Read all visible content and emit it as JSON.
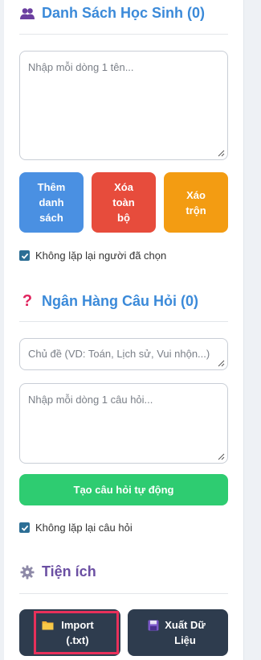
{
  "students": {
    "title": "Danh Sách Học Sinh (0)",
    "icon": "people-icon",
    "textarea_placeholder": "Nhập mỗi dòng 1 tên...",
    "buttons": {
      "add": "Thêm danh sách",
      "delete_all": "Xóa toàn bộ",
      "shuffle": "Xáo trộn"
    },
    "no_repeat_label": "Không lặp lại người đã chọn",
    "no_repeat_checked": true
  },
  "questions": {
    "title": "Ngân Hàng Câu Hỏi (0)",
    "icon": "question-mark-icon",
    "topic_placeholder": "Chủ đề (VD: Toán, Lịch sử, Vui nhộn...)",
    "textarea_placeholder": "Nhập mỗi dòng 1 câu hỏi...",
    "generate_button": "Tạo câu hỏi tự động",
    "no_repeat_label": "Không lặp lại câu hỏi",
    "no_repeat_checked": true
  },
  "utilities": {
    "title": "Tiện ích",
    "icon": "gear-icon",
    "import_button": "Import (.txt)",
    "import_icon": "folder-icon",
    "export_button": "Xuất Dữ Liệu",
    "export_icon": "floppy-disk-icon"
  },
  "colors": {
    "blue_button": "#4a90e2",
    "red_button": "#e74c3c",
    "orange_button": "#f39c12",
    "green_button": "#2ecc71",
    "dark_button": "#2e3c4e",
    "title_blue": "#3b8ad9",
    "highlight": "#e8305a"
  }
}
